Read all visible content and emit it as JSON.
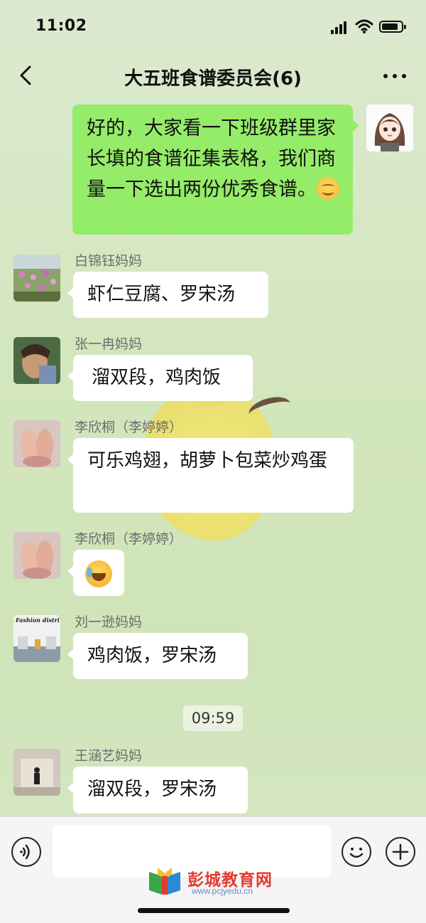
{
  "status_bar": {
    "time": "11:02"
  },
  "nav": {
    "title": "大五班食谱委员会(6)"
  },
  "messages": [
    {
      "sender": "",
      "text": "好的，大家看一下班级群里家长填的食谱征集表格，我们商量一下选出两份优秀食谱。",
      "is_self": true
    },
    {
      "sender": "白锦钰妈妈",
      "text": "虾仁豆腐、罗宋汤"
    },
    {
      "sender": "张一冉妈妈",
      "text": "溜双段，鸡肉饭"
    },
    {
      "sender": "李欣桐（李婷婷）",
      "text": "可乐鸡翅，胡萝卜包菜炒鸡蛋"
    },
    {
      "sender": "李欣桐（李婷婷）",
      "text": "",
      "emoji": "laughing-tears-emoji"
    },
    {
      "sender": "刘一逊妈妈",
      "text": "鸡肉饭，罗宋汤",
      "avatar_caption": "Fashion district"
    },
    {
      "sender": "王涵艺妈妈",
      "text": "溜双段，罗宋汤"
    }
  ],
  "time_badge": "09:59",
  "watermark": {
    "title": "彭城教育网",
    "url": "www.pcjyedu.cn"
  },
  "colors": {
    "self_bubble": "#95ec69",
    "background": "#d5e6c0",
    "other_bubble": "#ffffff"
  }
}
